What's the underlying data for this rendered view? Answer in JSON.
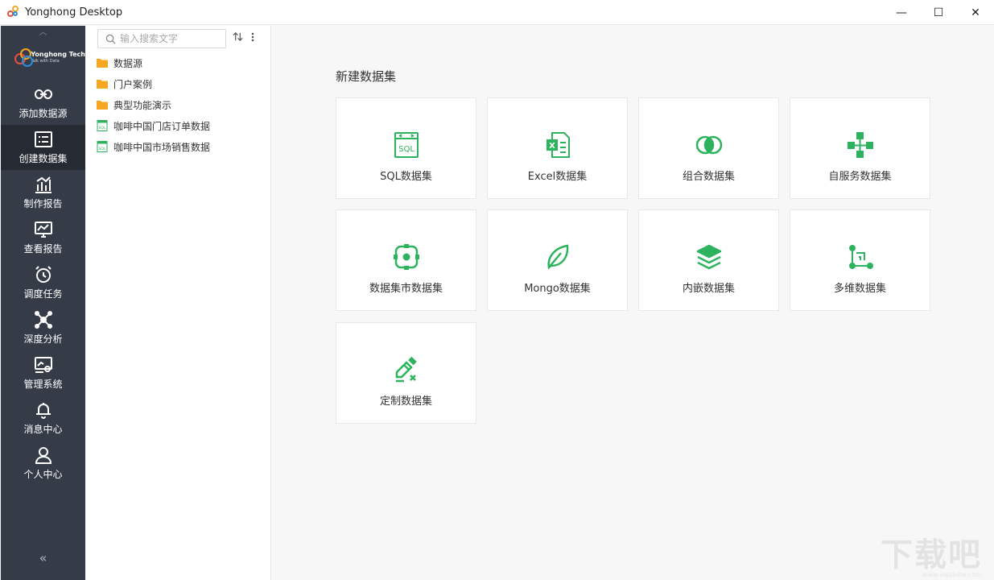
{
  "window": {
    "title": "Yonghong Desktop",
    "controls": {
      "minimize": "—",
      "maximize": "☐",
      "close": "✕"
    }
  },
  "sidebar": {
    "logo": {
      "name": "Yonghong Tech",
      "tagline": "Talk with Data"
    },
    "items": [
      {
        "label": "添加数据源",
        "icon": "link-icon",
        "active": false
      },
      {
        "label": "创建数据集",
        "icon": "dataset-icon",
        "active": true
      },
      {
        "label": "制作报告",
        "icon": "bar-chart-icon",
        "active": false
      },
      {
        "label": "查看报告",
        "icon": "monitor-chart-icon",
        "active": false
      },
      {
        "label": "调度任务",
        "icon": "alarm-clock-icon",
        "active": false
      },
      {
        "label": "深度分析",
        "icon": "network-icon",
        "active": false
      },
      {
        "label": "管理系统",
        "icon": "settings-screen-icon",
        "active": false
      },
      {
        "label": "消息中心",
        "icon": "bell-icon",
        "active": false
      },
      {
        "label": "个人中心",
        "icon": "user-icon",
        "active": false
      }
    ],
    "collapse_label": "«"
  },
  "tree": {
    "search_placeholder": "输入搜索文字",
    "items": [
      {
        "label": "数据源",
        "type": "folder"
      },
      {
        "label": "门户案例",
        "type": "folder"
      },
      {
        "label": "典型功能演示",
        "type": "folder"
      },
      {
        "label": "咖啡中国门店订单数据",
        "type": "sql-file"
      },
      {
        "label": "咖啡中国市场销售数据",
        "type": "sql-file"
      }
    ]
  },
  "main": {
    "title": "新建数据集",
    "cards": [
      {
        "label": "SQL数据集",
        "icon": "sql-icon"
      },
      {
        "label": "Excel数据集",
        "icon": "excel-icon"
      },
      {
        "label": "组合数据集",
        "icon": "combine-icon"
      },
      {
        "label": "自服务数据集",
        "icon": "flow-icon"
      },
      {
        "label": "数据集市数据集",
        "icon": "datamart-icon"
      },
      {
        "label": "Mongo数据集",
        "icon": "leaf-icon"
      },
      {
        "label": "内嵌数据集",
        "icon": "layers-icon"
      },
      {
        "label": "多维数据集",
        "icon": "cube-axis-icon"
      },
      {
        "label": "定制数据集",
        "icon": "custom-edit-icon"
      }
    ]
  },
  "colors": {
    "accent": "#2db35d",
    "sidebar_bg": "#353c48",
    "sidebar_active": "#262b33",
    "folder": "#f5a623"
  },
  "watermark": {
    "text": "下载吧",
    "sub": "www.xiazaiba.com"
  }
}
